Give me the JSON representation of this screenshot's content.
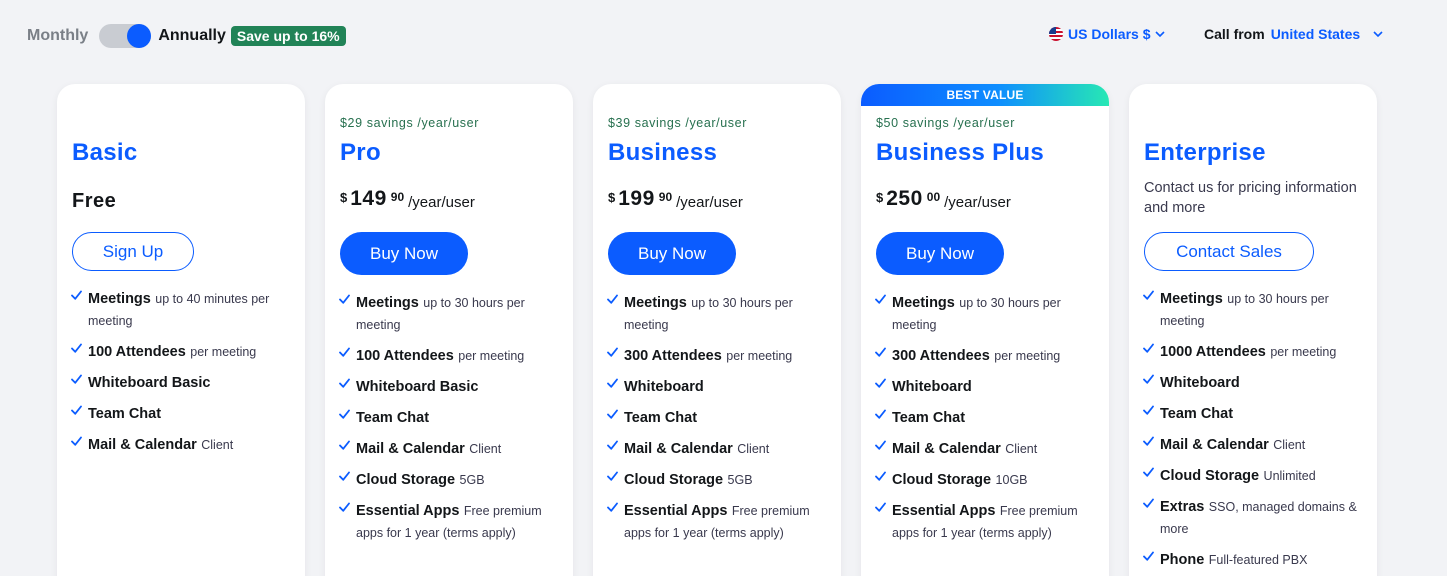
{
  "billing": {
    "monthly_label": "Monthly",
    "annually_label": "Annually",
    "save_badge": "Save up to 16%"
  },
  "currency": {
    "label": "US Dollars $"
  },
  "call_from": {
    "label": "Call from",
    "value": "United States"
  },
  "colors": {
    "brand": "#0b5cff",
    "savings_badge": "#218357"
  },
  "plans": [
    {
      "name": "Basic",
      "price_text": "Free",
      "button": "Sign Up",
      "features": [
        {
          "title": "Meetings",
          "desc": "up to 40 minutes per meeting"
        },
        {
          "title": "100 Attendees",
          "desc": "per meeting"
        },
        {
          "title": "Whiteboard Basic",
          "desc": ""
        },
        {
          "title": "Team Chat",
          "desc": ""
        },
        {
          "title": "Mail & Calendar",
          "desc": "Client"
        }
      ]
    },
    {
      "name": "Pro",
      "savings": "$29 savings /year/user",
      "currency_symbol": "$",
      "price_whole": "149",
      "price_cents": "90",
      "per": "/year/user",
      "button": "Buy Now",
      "features": [
        {
          "title": "Meetings",
          "desc": "up to 30 hours per meeting"
        },
        {
          "title": "100 Attendees",
          "desc": "per meeting"
        },
        {
          "title": "Whiteboard Basic",
          "desc": ""
        },
        {
          "title": "Team Chat",
          "desc": ""
        },
        {
          "title": "Mail & Calendar",
          "desc": "Client"
        },
        {
          "title": "Cloud Storage",
          "desc": "5GB"
        },
        {
          "title": "Essential Apps",
          "desc": "Free premium apps for 1 year (terms apply)"
        }
      ]
    },
    {
      "name": "Business",
      "savings": "$39 savings /year/user",
      "currency_symbol": "$",
      "price_whole": "199",
      "price_cents": "90",
      "per": "/year/user",
      "button": "Buy Now",
      "features": [
        {
          "title": "Meetings",
          "desc": "up to 30 hours per meeting"
        },
        {
          "title": "300 Attendees",
          "desc": "per meeting"
        },
        {
          "title": "Whiteboard",
          "desc": ""
        },
        {
          "title": "Team Chat",
          "desc": ""
        },
        {
          "title": "Mail & Calendar",
          "desc": "Client"
        },
        {
          "title": "Cloud Storage",
          "desc": "5GB"
        },
        {
          "title": "Essential Apps",
          "desc": "Free premium apps for 1 year (terms apply)"
        }
      ]
    },
    {
      "name": "Business Plus",
      "badge": "BEST VALUE",
      "savings": "$50 savings /year/user",
      "currency_symbol": "$",
      "price_whole": "250",
      "price_cents": "00",
      "per": "/year/user",
      "button": "Buy Now",
      "features": [
        {
          "title": "Meetings",
          "desc": "up to 30 hours per meeting"
        },
        {
          "title": "300 Attendees",
          "desc": "per meeting"
        },
        {
          "title": "Whiteboard",
          "desc": ""
        },
        {
          "title": "Team Chat",
          "desc": ""
        },
        {
          "title": "Mail & Calendar",
          "desc": "Client"
        },
        {
          "title": "Cloud Storage",
          "desc": "10GB"
        },
        {
          "title": "Essential Apps",
          "desc": "Free premium apps for 1 year (terms apply)"
        }
      ]
    },
    {
      "name": "Enterprise",
      "contact_text": "Contact us for pricing information and more",
      "button": "Contact Sales",
      "features": [
        {
          "title": "Meetings",
          "desc": "up to 30 hours per meeting"
        },
        {
          "title": "1000 Attendees",
          "desc": "per meeting"
        },
        {
          "title": "Whiteboard",
          "desc": ""
        },
        {
          "title": "Team Chat",
          "desc": ""
        },
        {
          "title": "Mail & Calendar",
          "desc": "Client"
        },
        {
          "title": "Cloud Storage",
          "desc": "Unlimited"
        },
        {
          "title": "Extras",
          "desc": "SSO, managed domains & more"
        },
        {
          "title": "Phone",
          "desc": "Full-featured PBX"
        }
      ]
    }
  ]
}
